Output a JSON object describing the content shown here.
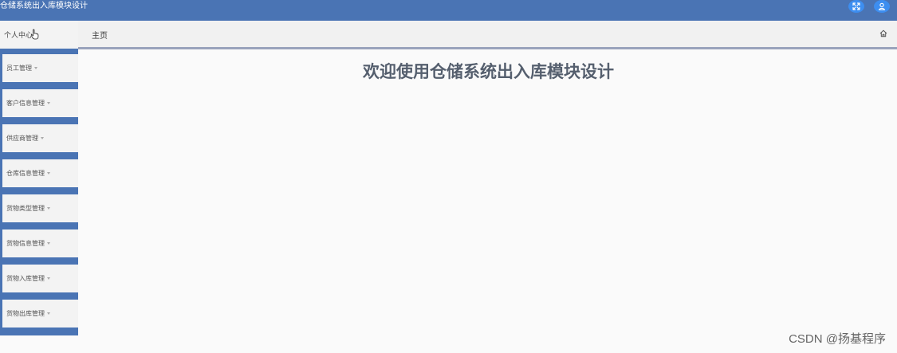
{
  "app": {
    "title": "仓储系统出入库模块设计"
  },
  "header": {
    "fullscreen_icon": "expand-arrows-icon",
    "user_icon": "user-icon",
    "accent_color": "#4a74b4",
    "button_color": "#3d8ef0"
  },
  "sidebar": {
    "items": [
      {
        "label": "个人中心"
      },
      {
        "label": "员工管理"
      },
      {
        "label": "客户信息管理"
      },
      {
        "label": "供应商管理"
      },
      {
        "label": "仓库信息管理"
      },
      {
        "label": "货物类型管理"
      },
      {
        "label": "货物信息管理"
      },
      {
        "label": "货物入库管理"
      },
      {
        "label": "货物出库管理"
      }
    ]
  },
  "breadcrumb": {
    "label": "主页",
    "home_icon": "home-icon"
  },
  "main": {
    "welcome": "欢迎使用仓储系统出入库模块设计"
  },
  "watermark": {
    "text": "CSDN @扬基程序"
  }
}
